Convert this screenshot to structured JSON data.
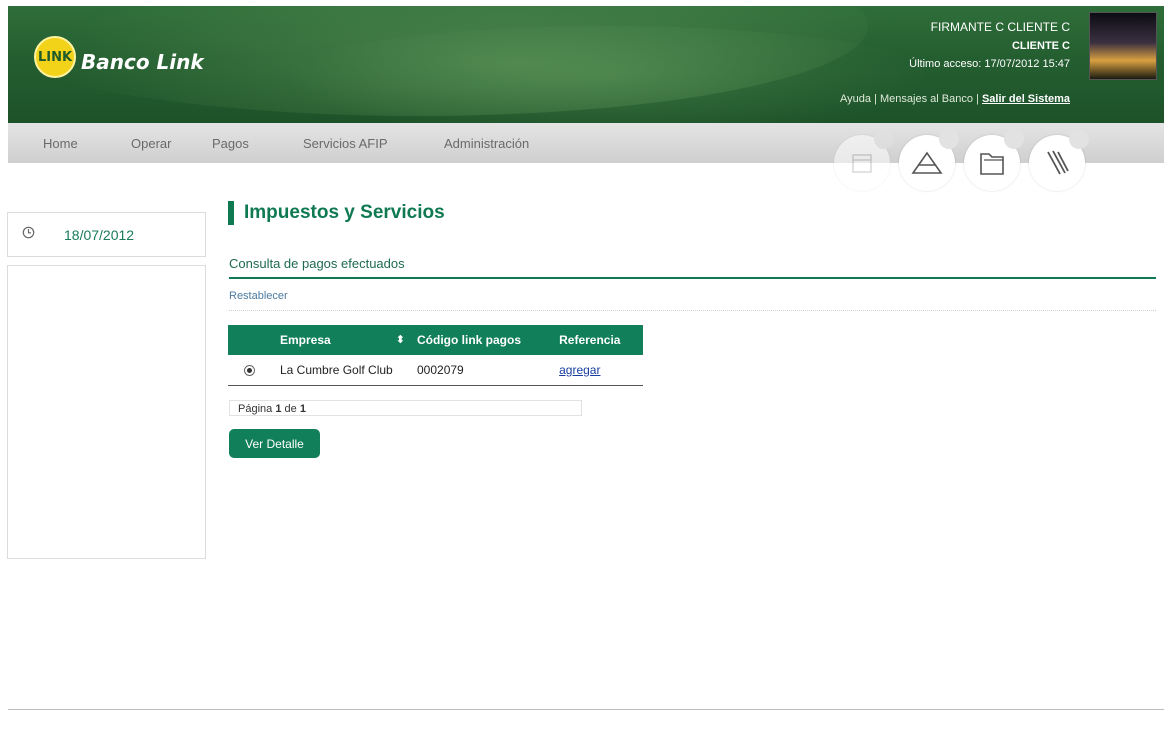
{
  "header": {
    "logo_text": "LINK",
    "bank_name": "Banco Link",
    "user_name": "FIRMANTE C CLIENTE C",
    "client": "CLIENTE C",
    "last_access": "Último acceso: 17/07/2012 15:47",
    "links": {
      "help": "Ayuda",
      "sep1": " | ",
      "messages": "Mensajes al Banco",
      "sep2": " | ",
      "logout": "Salir del Sistema"
    }
  },
  "nav": {
    "items": [
      "Home",
      "Operar",
      "Pagos",
      "Servicios AFIP",
      "Administración"
    ],
    "icons": [
      "calendar-icon",
      "envelope-icon",
      "folder-icon",
      "clip-icon"
    ]
  },
  "sidebar": {
    "date": "18/07/2012"
  },
  "main": {
    "title": "Impuestos y Servicios",
    "section": "Consulta de pagos efectuados",
    "reset": "Restablecer",
    "table": {
      "headers": [
        "Empresa",
        "Código link pagos",
        "Referencia"
      ],
      "rows": [
        {
          "empresa": "La Cumbre Golf Club",
          "codigo": "0002079",
          "referencia": "agregar"
        }
      ]
    },
    "pager": {
      "label": "Página",
      "page": "1",
      "of": "de",
      "total": "1"
    },
    "detail_button": "Ver Detalle"
  },
  "colors": {
    "header_green": "#245e30",
    "accent": "#117f5a",
    "link": "#1a3ea0"
  }
}
